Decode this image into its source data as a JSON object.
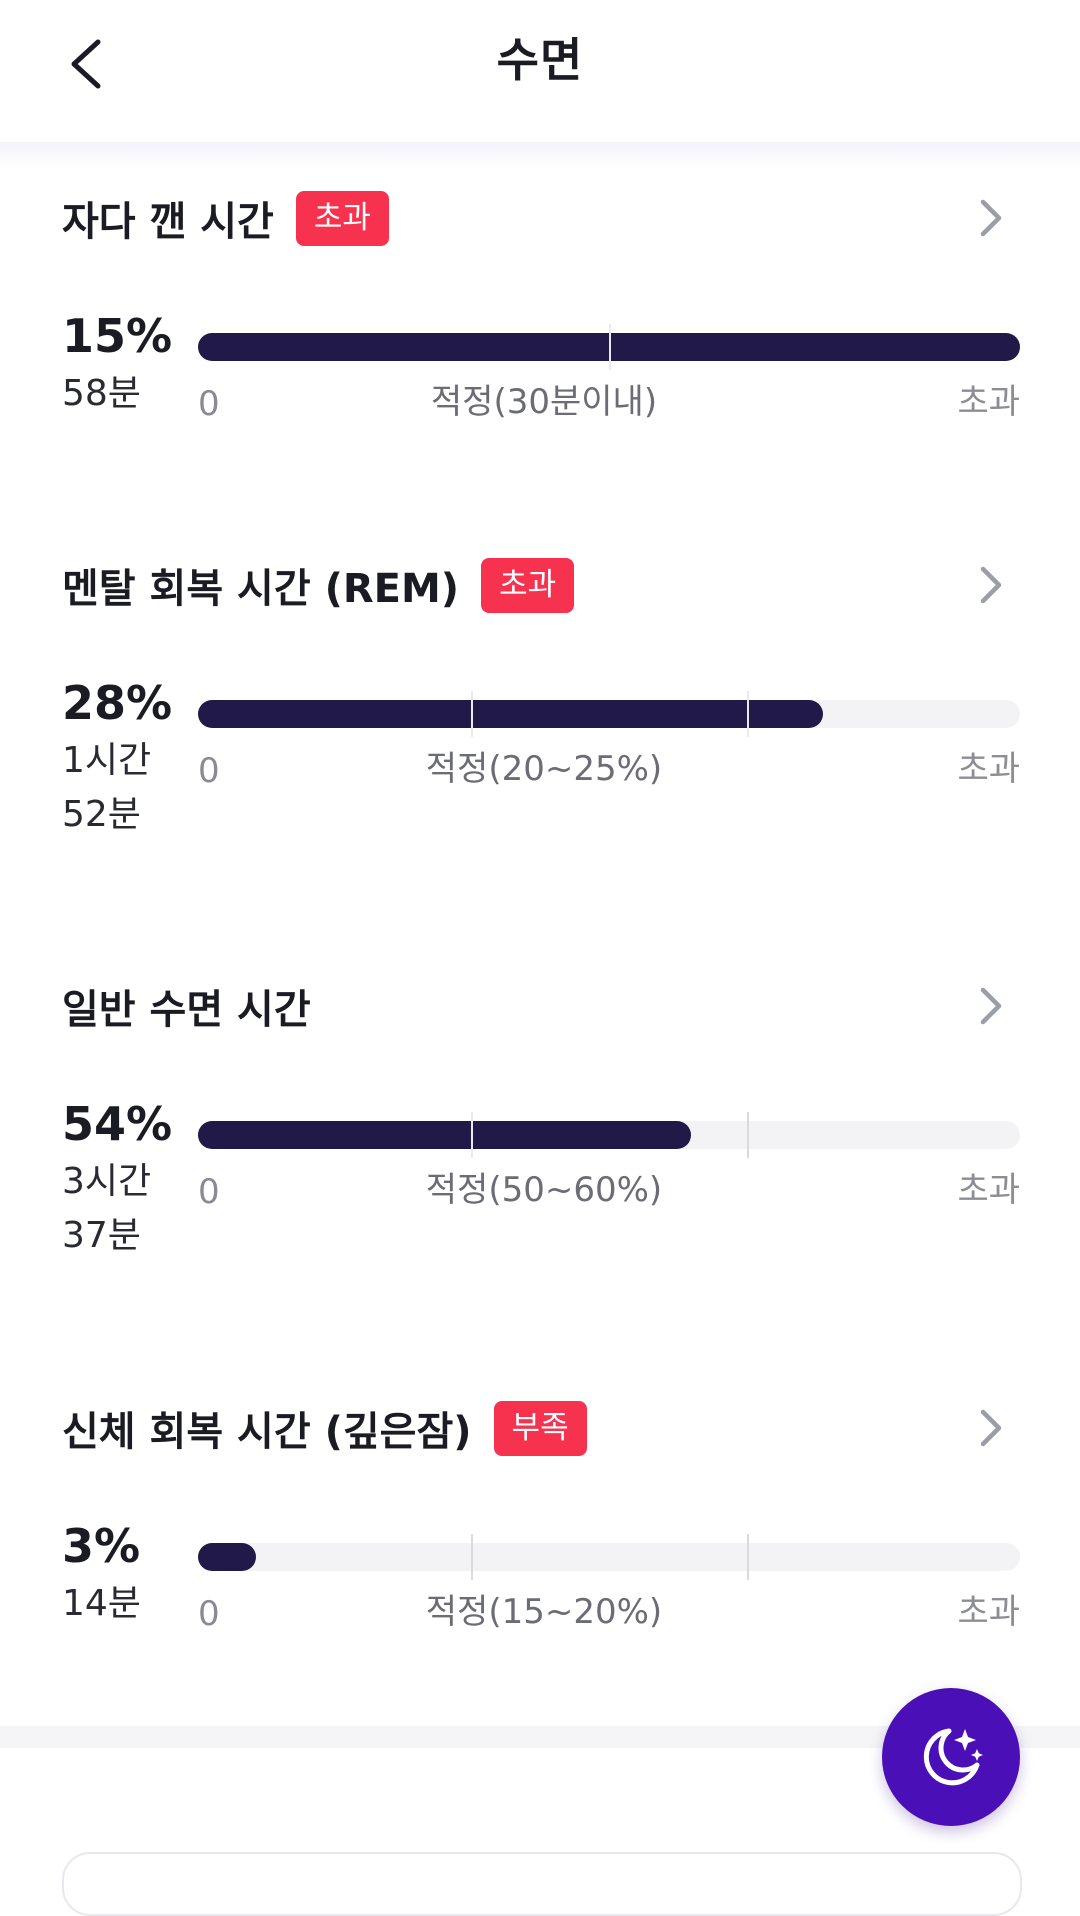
{
  "header": {
    "title": "수면"
  },
  "sections": [
    {
      "title": "자다 깬 시간",
      "badge": "초과",
      "percent": "15%",
      "duration": [
        "58분"
      ],
      "fill_fraction": 1.0,
      "scale": {
        "zero": "0",
        "mid": "적정(30분이내)",
        "over": "초과"
      }
    },
    {
      "title": "멘탈 회복 시간 (REM)",
      "badge": "초과",
      "percent": "28%",
      "duration": [
        "1시간",
        "52분"
      ],
      "fill_fraction": 0.76,
      "scale": {
        "zero": "0",
        "mid": "적정(20~25%)",
        "over": "초과"
      }
    },
    {
      "title": "일반 수면 시간",
      "badge": "",
      "percent": "54%",
      "duration": [
        "3시간",
        "37분"
      ],
      "fill_fraction": 0.6,
      "scale": {
        "zero": "0",
        "mid": "적정(50~60%)",
        "over": "초과"
      }
    },
    {
      "title": "신체 회복 시간 (깊은잠)",
      "badge": "부족",
      "percent": "3%",
      "duration": [
        "14분"
      ],
      "fill_fraction": 0.07,
      "scale": {
        "zero": "0",
        "mid": "적정(15~20%)",
        "over": "초과"
      }
    }
  ],
  "icons": {
    "back": "back-arrow-icon",
    "chevron": "chevron-right-icon",
    "fab": "moon-stars-icon"
  },
  "colors": {
    "badge": "#f7324f",
    "bar_fill": "#211a48",
    "bar_track": "#f3f3f6",
    "fab": "#4a0fb7"
  }
}
